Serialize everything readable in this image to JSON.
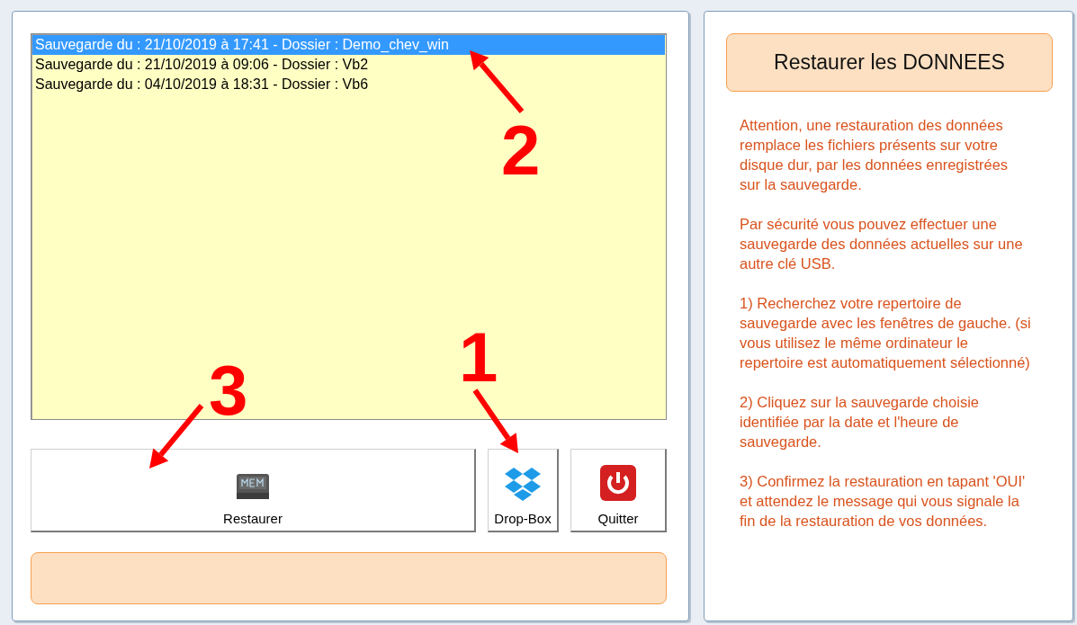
{
  "backups": [
    {
      "label": "Sauvegarde du : 21/10/2019 à 17:41 - Dossier : Demo_chev_win",
      "selected": true
    },
    {
      "label": "Sauvegarde du : 21/10/2019 à 09:06 - Dossier : Vb2",
      "selected": false
    },
    {
      "label": "Sauvegarde du : 04/10/2019 à 18:31 - Dossier : Vb6",
      "selected": false
    }
  ],
  "buttons": [
    {
      "kind": "memory",
      "label": "Restaurer"
    },
    {
      "kind": "dropbox",
      "label": "Drop-Box"
    },
    {
      "kind": "power",
      "label": "Quitter"
    }
  ],
  "info_panel": {
    "title": "Restaurer les DONNEES",
    "paragraphs": [
      "Attention, une restauration des données remplace les fichiers présents sur votre disque dur, par les données enregistrées sur la sauvegarde.",
      "Par sécurité vous pouvez effectuer une sauvegarde des données actuelles sur une autre clé USB.",
      "1) Recherchez votre repertoire de sauvegarde avec les fenêtres de gauche. (si vous utilisez le même ordinateur le repertoire est automatiquement sélectionné)",
      "2) Cliquez sur la sauvegarde choisie identifiée par la date et l'heure de sauvegarde.",
      "3) Confirmez la restauration en tapant 'OUI' et attendez le message qui vous signale la fin de la restauration de vos données."
    ]
  },
  "annotations": [
    {
      "number": "2",
      "kind": "list"
    },
    {
      "number": "1",
      "kind": "dropbox"
    },
    {
      "number": "3",
      "kind": "restore"
    }
  ]
}
